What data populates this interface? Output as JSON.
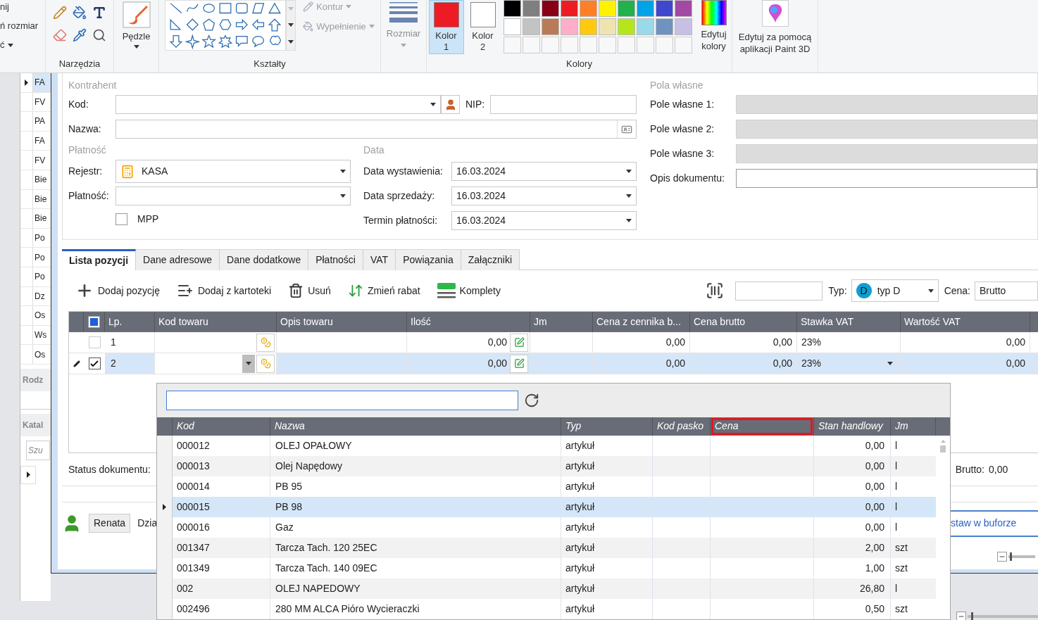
{
  "ribbon": {
    "cut_group": [
      {
        "label": "nij",
        "dropdown": false
      },
      {
        "label": "ń rozmiar",
        "dropdown": false
      },
      {
        "label": "ć",
        "dropdown": true
      }
    ],
    "tools_label": "Narzędzia",
    "brushes": "Pędzle",
    "shapes_label": "Kształty",
    "outline": {
      "label": "Kontur",
      "disabled": true
    },
    "fill": {
      "label": "Wypełnienie",
      "disabled": true
    },
    "size": {
      "label": "Rozmiar",
      "disabled": true
    },
    "color_slots": [
      {
        "label": "Kolor",
        "number": "1",
        "color": "#ed1c24",
        "selected": true
      },
      {
        "label": "Kolor",
        "number": "2",
        "color": "#ffffff",
        "selected": false
      }
    ],
    "palette": [
      {
        "color": "#000000"
      },
      {
        "color": "#7f7f7f"
      },
      {
        "color": "#880015"
      },
      {
        "color": "#ed1c24"
      },
      {
        "color": "#ff7f27"
      },
      {
        "color": "#fff200"
      },
      {
        "color": "#22b14c"
      },
      {
        "color": "#00a2e8"
      },
      {
        "color": "#3f48cc"
      },
      {
        "color": "#a349a4"
      },
      {
        "color": "#ffffff"
      },
      {
        "color": "#c3c3c3"
      },
      {
        "color": "#b97a57"
      },
      {
        "color": "#ffaec9"
      },
      {
        "color": "#ffc90e"
      },
      {
        "color": "#efe4b0"
      },
      {
        "color": "#b5e61d"
      },
      {
        "color": "#99d9ea"
      },
      {
        "color": "#7092be"
      },
      {
        "color": "#c8bfe7"
      }
    ],
    "edit_colors": "Edytuj kolory",
    "colors_label": "Kolory",
    "paint3d": "Edytuj za pomocą aplikacji Paint 3D"
  },
  "left_list": {
    "rows": [
      {
        "text": "FA",
        "selected": true
      },
      {
        "text": "FV",
        "selected": false
      },
      {
        "text": "PA",
        "selected": false
      },
      {
        "text": "FA",
        "selected": false
      },
      {
        "text": "FV",
        "selected": false
      },
      {
        "text": "Bie",
        "selected": false
      },
      {
        "text": "Bie",
        "selected": false
      },
      {
        "text": "Bie",
        "selected": false
      },
      {
        "text": "Po",
        "selected": false
      },
      {
        "text": "Po",
        "selected": false
      },
      {
        "text": "Po",
        "selected": false
      },
      {
        "text": "Dz",
        "selected": false
      },
      {
        "text": "Os",
        "selected": false
      },
      {
        "text": "Ws",
        "selected": false
      },
      {
        "text": "Os",
        "selected": false
      }
    ],
    "section_1": "Rodz",
    "section_2": "Katal",
    "search_placeholder": "Szu"
  },
  "contractor": {
    "legend": "Kontrahent",
    "code_label": "Kod:",
    "nip_label": "NIP:",
    "name_label": "Nazwa:"
  },
  "payment": {
    "legend": "Płatność",
    "register_label": "Rejestr:",
    "register": "KASA",
    "payment_label": "Płatność:",
    "mpp": {
      "label": "MPP",
      "checked": false
    }
  },
  "dates": {
    "legend": "Data",
    "fields": [
      {
        "label": "Data wystawienia:",
        "value": "16.03.2024"
      },
      {
        "label": "Data sprzedaży:",
        "value": "16.03.2024"
      },
      {
        "label": "Termin płatności:",
        "value": "16.03.2024"
      }
    ]
  },
  "custom_fields": {
    "legend": "Pola własne",
    "fields": [
      {
        "label": "Pole własne 1:",
        "disabled": true
      },
      {
        "label": "Pole własne 2:",
        "disabled": true
      },
      {
        "label": "Pole własne 3:",
        "disabled": true
      },
      {
        "label": "Opis dokumentu:",
        "disabled": false
      }
    ]
  },
  "tabs": [
    {
      "label": "Lista pozycji",
      "selected": true
    },
    {
      "label": "Dane adresowe",
      "selected": false
    },
    {
      "label": "Dane dodatkowe",
      "selected": false
    },
    {
      "label": "Płatności",
      "selected": false
    },
    {
      "label": "VAT",
      "selected": false
    },
    {
      "label": "Powiązania",
      "selected": false
    },
    {
      "label": "Załączniki",
      "selected": false
    }
  ],
  "toolbar": {
    "actions": [
      {
        "label": "Dodaj pozycję",
        "kind": "add"
      },
      {
        "label": "Dodaj z kartoteki",
        "kind": "catalog"
      },
      {
        "label": "Usuń",
        "kind": "delete"
      },
      {
        "label": "Zmień rabat",
        "kind": "discount"
      },
      {
        "label": "Komplety",
        "kind": "sets"
      }
    ],
    "type_label": "Typ:",
    "type_badge": "D",
    "type_value": "typ D",
    "price_label": "Cena:",
    "price_value": "Brutto"
  },
  "grid": {
    "header_indeterminate": true,
    "columns": [
      "Lp.",
      "Kod towaru",
      "Opis towaru",
      "Ilość",
      "Jm",
      "Cena z cennika b...",
      "Cena brutto",
      "Stawka VAT",
      "Wartość VAT"
    ],
    "rows": [
      {
        "lp": "1",
        "quantity": "0,00",
        "list_price": "0,00",
        "gross_price": "0,00",
        "vat_rate": "23%",
        "vat_value": "0,00",
        "checked": false,
        "selected": false,
        "editing": false
      },
      {
        "lp": "2",
        "quantity": "0,00",
        "list_price": "0,00",
        "gross_price": "0,00",
        "vat_rate": "23%",
        "vat_value": "0,00",
        "checked": true,
        "selected": true,
        "editing": true
      }
    ]
  },
  "status": {
    "label": "Status dokumentu:",
    "gross_label": "Brutto:",
    "gross_value": "0,00"
  },
  "zoom_sliders": [
    {
      "level": 0.05
    },
    {
      "level": 0.05
    }
  ],
  "footer": {
    "user": "Renata",
    "department": "Dzia",
    "link": "staw w buforze"
  },
  "popup": {
    "columns": [
      {
        "label": "Kod",
        "highlighted": false
      },
      {
        "label": "Nazwa",
        "highlighted": false
      },
      {
        "label": "Typ",
        "highlighted": false
      },
      {
        "label": "Kod pasko",
        "highlighted": false
      },
      {
        "label": "Cena",
        "highlighted": true
      },
      {
        "label": "Stan handlowy",
        "highlighted": false
      },
      {
        "label": "Jm",
        "highlighted": false
      }
    ],
    "rows": [
      {
        "code": "000012",
        "name": "OLEJ OPAŁOWY",
        "type": "artykuł",
        "stock": "0,00",
        "unit": "l",
        "selected": false
      },
      {
        "code": "000013",
        "name": "Olej Napędowy",
        "type": "artykuł",
        "stock": "0,00",
        "unit": "l",
        "selected": false
      },
      {
        "code": "000014",
        "name": "PB 95",
        "type": "artykuł",
        "stock": "0,00",
        "unit": "l",
        "selected": false
      },
      {
        "code": "000015",
        "name": "PB 98",
        "type": "artykuł",
        "stock": "0,00",
        "unit": "l",
        "selected": true
      },
      {
        "code": "000016",
        "name": "Gaz",
        "type": "artykuł",
        "stock": "0,00",
        "unit": "l",
        "selected": false
      },
      {
        "code": "001347",
        "name": "Tarcza Tach. 120 25EC",
        "type": "artykuł",
        "stock": "2,00",
        "unit": "szt",
        "selected": false
      },
      {
        "code": "001349",
        "name": "Tarcza Tach. 140 09EC",
        "type": "artykuł",
        "stock": "1,00",
        "unit": "szt",
        "selected": false
      },
      {
        "code": "002",
        "name": "OLEJ NAPEDOWY",
        "type": "artykuł",
        "stock": "26,80",
        "unit": "l",
        "selected": false
      },
      {
        "code": "002496",
        "name": "280 MM ALCA Pióro Wycieraczki",
        "type": "artykuł",
        "stock": "0,50",
        "unit": "szt",
        "selected": false
      }
    ]
  }
}
